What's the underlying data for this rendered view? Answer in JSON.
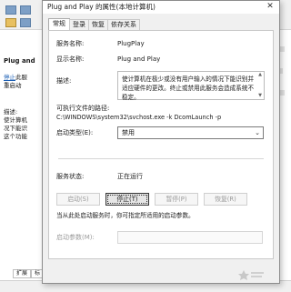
{
  "background_window": {
    "left_pane_title": "Plug and",
    "left_pane_link": "停止",
    "left_pane_link_suffix": "此服",
    "left_pane_line2": "重启动",
    "left_pane_desc_label": "描述:",
    "left_pane_desc_lines": [
      "使计算机",
      "况下能识",
      "这个功能"
    ],
    "bottom_tabs": [
      "扩展",
      "标"
    ]
  },
  "dialog": {
    "title": "Plug and Play 的属性(本地计算机)",
    "tabs": [
      "常规",
      "登录",
      "恢复",
      "依存关系"
    ],
    "fields": {
      "service_name_label": "服务名称:",
      "service_name_value": "PlugPlay",
      "display_name_label": "显示名称:",
      "display_name_value": "Plug and Play",
      "description_label": "描述:",
      "description_value": "使计算机在极少或没有用户输入的情况下能识别并适应硬件的更改。终止或禁用此服务会造成系统不稳定。",
      "exec_path_label": "可执行文件的路径:",
      "exec_path_value": "C:\\WINDOWS\\system32\\svchost.exe -k DcomLaunch -p",
      "startup_type_label": "启动类型(E):",
      "startup_type_value": "禁用"
    },
    "status": {
      "label": "服务状态:",
      "value": "正在运行"
    },
    "buttons": {
      "start": "启动(S)",
      "stop": "停止(T)",
      "pause": "暂停(P)",
      "resume": "恢复(R)"
    },
    "hint": "当从此处启动服务时，你可指定所适用的启动参数。",
    "start_params_label": "启动参数(M):",
    "start_params_value": ""
  },
  "colors": {
    "accent_link": "#1b5fb5",
    "disabled_text": "#9a9a9a"
  },
  "icons": [
    "close-icon",
    "chevron-down-icon",
    "scroll-up-icon",
    "scroll-down-icon"
  ]
}
